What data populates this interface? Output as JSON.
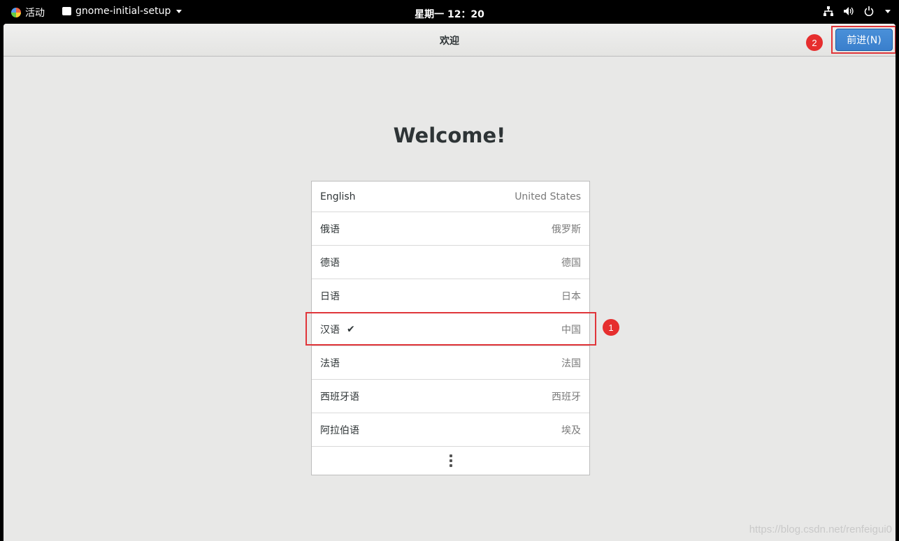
{
  "topbar": {
    "activities_label": "活动",
    "app_name": "gnome-initial-setup",
    "clock": "星期一 12：20",
    "icons": [
      "network-icon",
      "volume-icon",
      "power-icon"
    ]
  },
  "window": {
    "title": "欢迎",
    "next_button": "前进(N)"
  },
  "main": {
    "heading": "Welcome!",
    "languages": [
      {
        "name": "English",
        "region": "United States",
        "selected": false
      },
      {
        "name": "俄语",
        "region": "俄罗斯",
        "selected": false
      },
      {
        "name": "德语",
        "region": "德国",
        "selected": false
      },
      {
        "name": "日语",
        "region": "日本",
        "selected": false
      },
      {
        "name": "汉语",
        "region": "中国",
        "selected": true
      },
      {
        "name": "法语",
        "region": "法国",
        "selected": false
      },
      {
        "name": "西班牙语",
        "region": "西班牙",
        "selected": false
      },
      {
        "name": "阿拉伯语",
        "region": "埃及",
        "selected": false
      }
    ],
    "check_mark": "✔"
  },
  "annotations": {
    "badge_1": "1",
    "badge_2": "2"
  },
  "watermark": "https://blog.csdn.net/renfeigui0",
  "colors": {
    "accent": "#3a7fcc",
    "annotation_red": "#e0353a",
    "topbar": "#000000",
    "background": "#e8e8e7"
  }
}
